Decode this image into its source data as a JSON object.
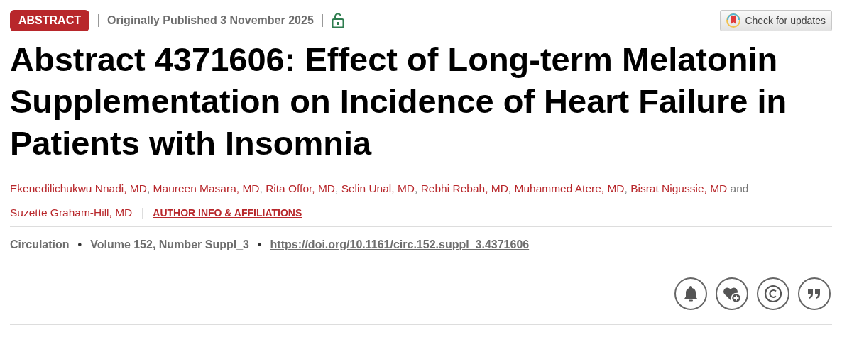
{
  "header": {
    "badge": "ABSTRACT",
    "published": "Originally Published 3 November 2025",
    "open_access": true,
    "updates_button": "Check for updates"
  },
  "title": "Abstract 4371606: Effect of Long-term Melatonin Supplementation on Incidence of Heart Failure in Patients with Insomnia",
  "authors": [
    "Ekenedilichukwu Nnadi, MD",
    "Maureen Masara, MD",
    "Rita Offor, MD",
    "Selin Unal, MD",
    "Rebhi Rebah, MD",
    "Muhammed Atere, MD",
    "Bisrat Nigussie, MD",
    "Suzette Graham-Hill, MD"
  ],
  "author_separator": ",",
  "author_conjunction": "and",
  "author_info_link": "AUTHOR INFO & AFFILIATIONS",
  "citation": {
    "journal": "Circulation",
    "bullet": "•",
    "volume": "Volume 152, Number Suppl_3",
    "doi": "https://doi.org/10.1161/circ.152.suppl_3.4371606"
  },
  "actions": [
    {
      "kind": "alert"
    },
    {
      "kind": "favorite"
    },
    {
      "kind": "permissions"
    },
    {
      "kind": "cite"
    }
  ]
}
